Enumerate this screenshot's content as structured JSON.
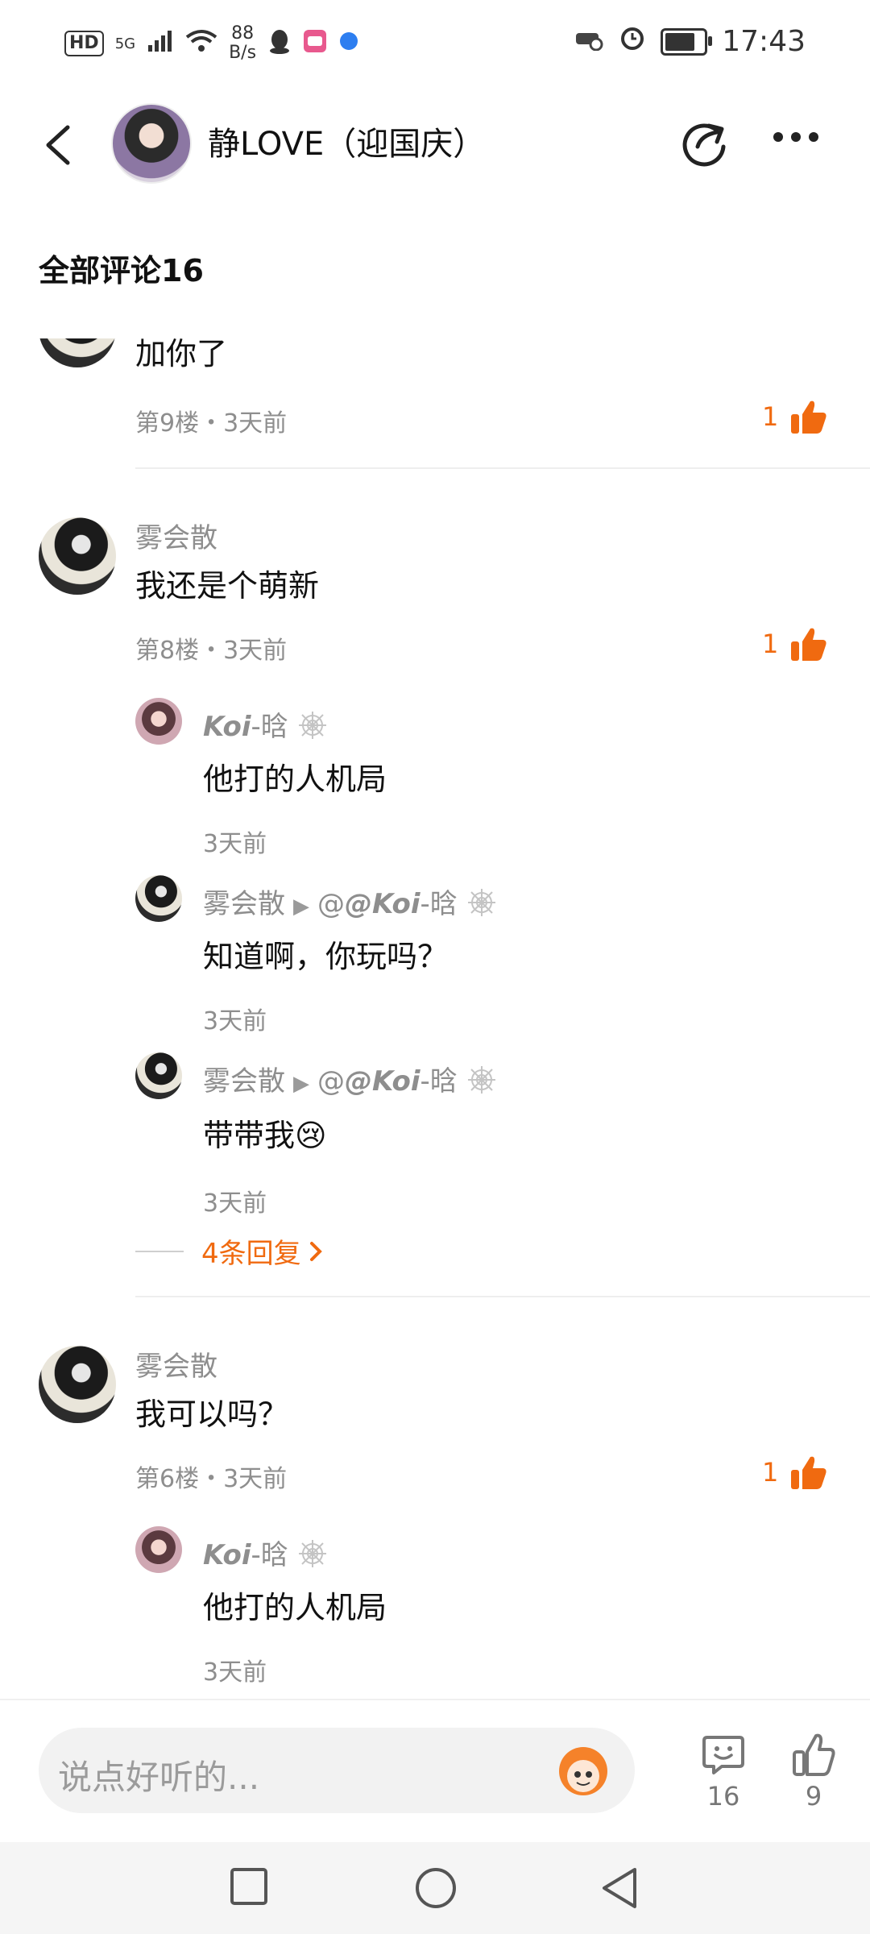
{
  "status": {
    "hd": "HD",
    "network": "5G",
    "net_speed_value": "88",
    "net_speed_unit": "B/s",
    "battery_level": 0.9,
    "time": "17:43"
  },
  "header": {
    "title": "静LOVE（迎国庆）"
  },
  "comments_title": "全部评论16",
  "comments": {
    "c9": {
      "text": "加你了",
      "meta": "第9楼・3天前",
      "likes": "1"
    },
    "c8": {
      "user": "雾会散",
      "text": "我还是个萌新",
      "meta": "第8楼・3天前",
      "likes": "1",
      "replies": [
        {
          "user_a": "Koi",
          "user_b": "-晗",
          "text": "他打的人机局",
          "time": "3天前"
        },
        {
          "user": "雾会散",
          "target_a": "@Koi",
          "target_b": "-晗",
          "text": "知道啊，你玩吗？",
          "time": "3天前"
        },
        {
          "user": "雾会散",
          "target_a": "@Koi",
          "target_b": "-晗",
          "text": "带带我😢",
          "time": "3天前"
        }
      ],
      "more_replies": "4条回复"
    },
    "c6": {
      "user": "雾会散",
      "text": "我可以吗？",
      "meta": "第6楼・3天前",
      "likes": "1",
      "replies": [
        {
          "user_a": "Koi",
          "user_b": "-晗",
          "text": "他打的人机局",
          "time": "3天前"
        }
      ]
    }
  },
  "bottom": {
    "input_placeholder": "说点好听的...",
    "comment_count": "16",
    "like_count": "9"
  },
  "colors": {
    "accent": "#f06a10",
    "muted": "#8e8e8e"
  }
}
